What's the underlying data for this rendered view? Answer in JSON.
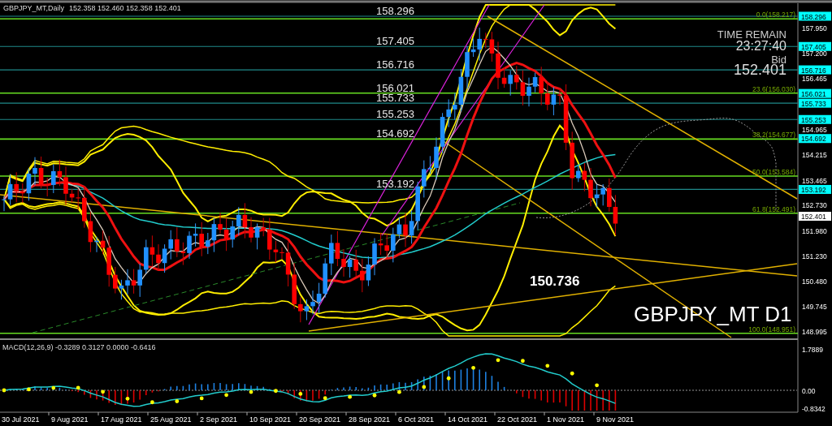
{
  "header": {
    "symbol": "GBPJPY_MT,Daily",
    "ohlc": "152.358 152.460 152.358 152.401"
  },
  "levels": [
    {
      "label": "158.296",
      "axis_label": "158.296"
    },
    {
      "label": "157.405",
      "axis_label": "157.405"
    },
    {
      "label": "156.716",
      "axis_label": "156.716"
    },
    {
      "label": "156.021",
      "axis_label": "156.021"
    },
    {
      "label": "155.733",
      "axis_label": "155.733"
    },
    {
      "label": "155.253",
      "axis_label": "155.253"
    },
    {
      "label": "154.692",
      "axis_label": "154.692"
    },
    {
      "label": "153.192",
      "axis_label": "153.192"
    }
  ],
  "fib_levels": [
    {
      "label": "0.0(158.217)"
    },
    {
      "label": "23.6(156.030)"
    },
    {
      "label": "38.2(154.677)"
    },
    {
      "label": "50.0(153.584)"
    },
    {
      "label": "61.8(152.491)"
    },
    {
      "label": "100.0(148.951)"
    }
  ],
  "price_axis": {
    "ticks": [
      "157.950",
      "157.200",
      "156.465",
      "154.965",
      "154.215",
      "153.465",
      "152.730",
      "151.980",
      "151.230",
      "150.480",
      "149.745",
      "148.995"
    ],
    "current_price": "152.401"
  },
  "time_remain": {
    "label": "TIME REMAIN",
    "value": "23:27:40",
    "bid_label": "Bid",
    "bid": "152.401"
  },
  "low_label": "150.736",
  "chart_symbol": "GBPJPY_MT D1",
  "macd": {
    "title": "MACD(12,26,9) -0.3289 0.3127 0.0000 -0.6416",
    "ticks": [
      "1.7889",
      "0.00",
      "-0.8342"
    ]
  },
  "dates": [
    "30 Jul 2021",
    "9 Aug 2021",
    "17 Aug 2021",
    "25 Aug 2021",
    "2 Sep 2021",
    "10 Sep 2021",
    "20 Sep 2021",
    "28 Sep 2021",
    "6 Oct 2021",
    "14 Oct 2021",
    "22 Oct 2021",
    "1 Nov 2021",
    "9 Nov 2021"
  ]
}
